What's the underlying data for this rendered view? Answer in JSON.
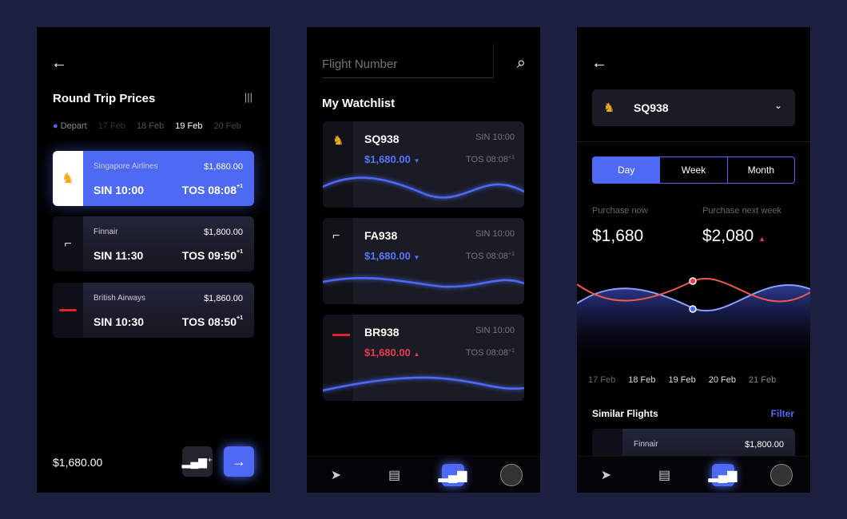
{
  "colors": {
    "accent": "#4e6af5",
    "up": "#e83a4a",
    "background": "#1d2140"
  },
  "screen1": {
    "title": "Round Trip Prices",
    "depart_label": "Depart",
    "dates": [
      "17 Feb",
      "18 Feb",
      "19 Feb",
      "20 Feb"
    ],
    "selected_date": "19 Feb",
    "flights": [
      {
        "airline": "Singapore Airlines",
        "price": "$1,680.00",
        "dep": "SIN 10:00",
        "arr": "TOS 08:08",
        "plus": "+1",
        "selected": true
      },
      {
        "airline": "Finnair",
        "price": "$1,800.00",
        "dep": "SIN 11:30",
        "arr": "TOS 09:50",
        "plus": "+1"
      },
      {
        "airline": "British Airways",
        "price": "$1,860.00",
        "dep": "SIN 10:30",
        "arr": "TOS 08:50",
        "plus": "+1"
      }
    ],
    "total": "$1,680.00"
  },
  "screen2": {
    "search_placeholder": "Flight Number",
    "title": "My Watchlist",
    "items": [
      {
        "code": "SQ938",
        "price": "$1,680.00",
        "trend": "down",
        "dep": "SIN 10:00",
        "arr": "TOS 08:08",
        "plus": "+1"
      },
      {
        "code": "FA938",
        "price": "$1,680.00",
        "trend": "down",
        "dep": "SIN 10:00",
        "arr": "TOS 08:08",
        "plus": "+1"
      },
      {
        "code": "BR938",
        "price": "$1,680.00",
        "trend": "up",
        "dep": "SIN 10:00",
        "arr": "TOS 08:08",
        "plus": "+1"
      }
    ]
  },
  "screen3": {
    "flight_select": "SQ938",
    "tabs": [
      "Day",
      "Week",
      "Month"
    ],
    "active_tab": "Day",
    "now_label": "Purchase now",
    "now_value": "$1,680",
    "next_label": "Purchase next week",
    "next_value": "$2,080",
    "dates": [
      "17 Feb",
      "18 Feb",
      "19 Feb",
      "20 Feb",
      "21 Feb"
    ],
    "similar_title": "Similar Flights",
    "filter": "Filter",
    "similar": [
      {
        "airline": "Finnair",
        "price": "$1,800.00"
      }
    ]
  },
  "nav": [
    "navigate",
    "tickets",
    "stats",
    "profile"
  ],
  "icons": {
    "back": "←",
    "search": "⌕",
    "bars": "📊"
  }
}
